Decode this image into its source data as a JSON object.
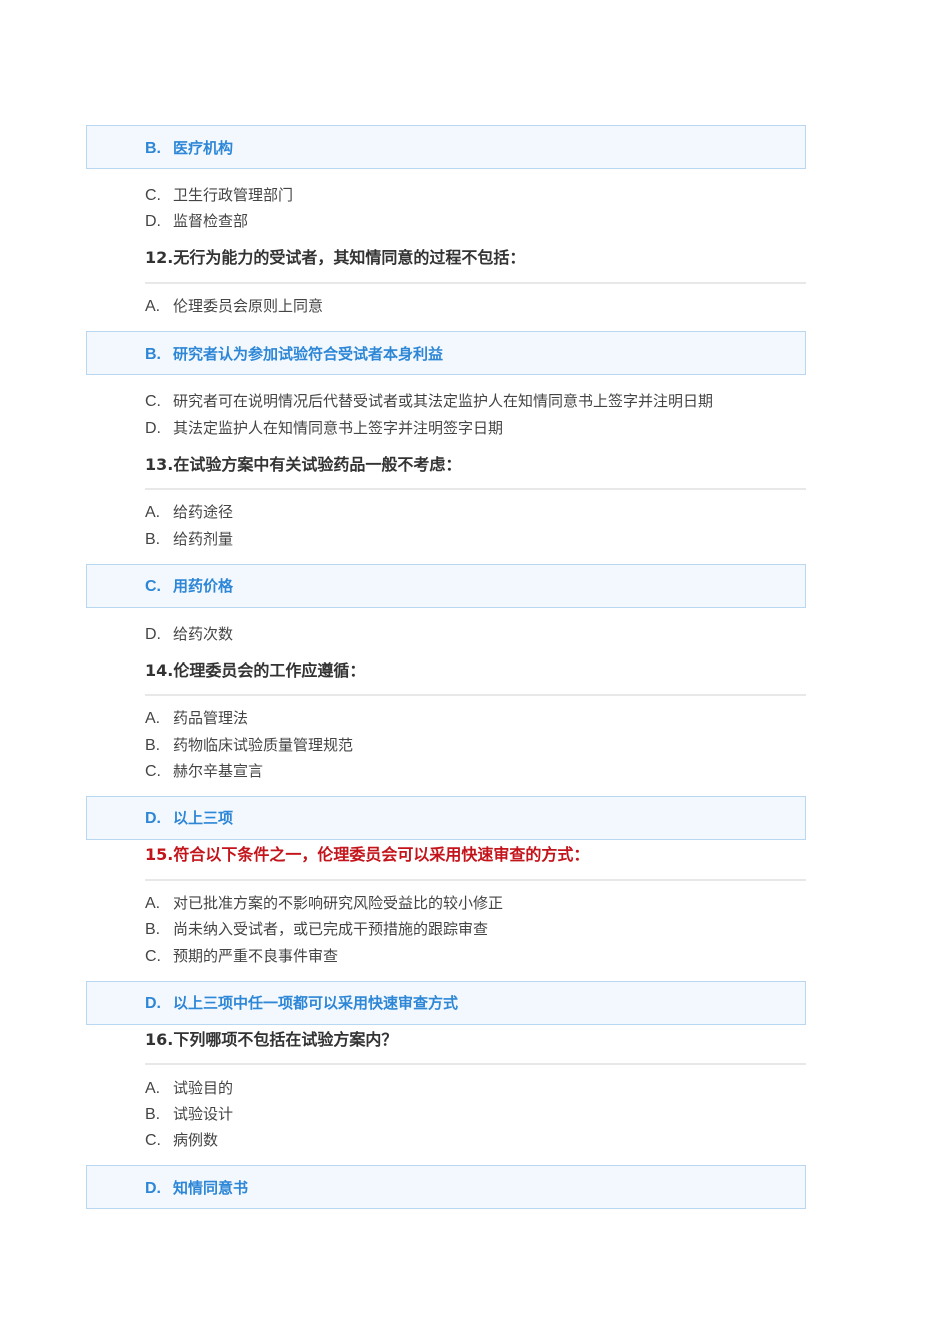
{
  "q11": {
    "B": "医疗机构",
    "C": "卫生行政管理部门",
    "D": "监督检查部"
  },
  "q12": {
    "title": "12.无行为能力的受试者，其知情同意的过程不包括：",
    "A": "伦理委员会原则上同意",
    "B": "研究者认为参加试验符合受试者本身利益",
    "C": "研究者可在说明情况后代替受试者或其法定监护人在知情同意书上签字并注明日期",
    "D": "其法定监护人在知情同意书上签字并注明签字日期"
  },
  "q13": {
    "title": "13.在试验方案中有关试验药品一般不考虑：",
    "A": "给药途径",
    "B": "给药剂量",
    "C": "用药价格",
    "D": "给药次数"
  },
  "q14": {
    "title": "14.伦理委员会的工作应遵循：",
    "A": "药品管理法",
    "B": "药物临床试验质量管理规范",
    "C": "赫尔辛基宣言",
    "D": "以上三项"
  },
  "q15": {
    "title": "15.符合以下条件之一，伦理委员会可以采用快速审查的方式：",
    "A": "对已批准方案的不影响研究风险受益比的较小修正",
    "B": "尚未纳入受试者，或已完成干预措施的跟踪审查",
    "C": "预期的严重不良事件审查",
    "D": "以上三项中任一项都可以采用快速审查方式"
  },
  "q16": {
    "title": "16.下列哪项不包括在试验方案内？",
    "A": "试验目的",
    "B": "试验设计",
    "C": "病例数",
    "D": "知情同意书"
  },
  "labels": {
    "A": "A.",
    "B": "B.",
    "C": "C.",
    "D": "D."
  },
  "colors": {
    "answer": "#2d86d6",
    "highlight_bg": "#f2f8fe",
    "highlight_border": "#b9d7f1",
    "alert": "#c3141b"
  }
}
